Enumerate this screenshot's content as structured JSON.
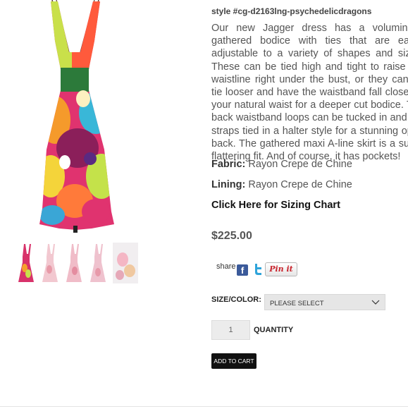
{
  "product": {
    "style_code": "style #cg-d2163lng-psychedelicdragons",
    "description": "Our new Jagger dress has a voluminous gathered bodice with ties that are easily adjustable to a variety of shapes and sizes. These can be tied high and tight to raise the waistline right under the bust, or they can be tie looser and have the waistband fall closer to your natural waist for a deeper cut bodice. The back waistband loops can be tucked in and the straps tied in a halter style for a stunning open back. The gathered maxi A-line skirt is a super flattering fit. And of course, it has pockets!",
    "fabric_label": "Fabric:",
    "fabric_value": " Rayon Crepe de Chine",
    "lining_label": "Lining:",
    "lining_value": " Rayon Crepe de Chine",
    "sizing_link": "Click Here for Sizing Chart",
    "price": "$225.00"
  },
  "share": {
    "label": "share",
    "facebook_icon": "facebook-icon",
    "twitter_icon": "twitter-icon",
    "pin_label": "Pin it"
  },
  "options": {
    "size_label": "SIZE/COLOR:",
    "size_selected": "PLEASE SELECT",
    "quantity_label": "QUANTITY",
    "quantity_value": "1",
    "add_to_cart": "ADD TO CART"
  },
  "gallery": {
    "thumbnail_count": 5
  },
  "colors": {
    "accent_black": "#111111",
    "facebook_blue": "#3b5a9a",
    "twitter_blue": "#2fa4da",
    "pinterest_red": "#c8232c"
  }
}
